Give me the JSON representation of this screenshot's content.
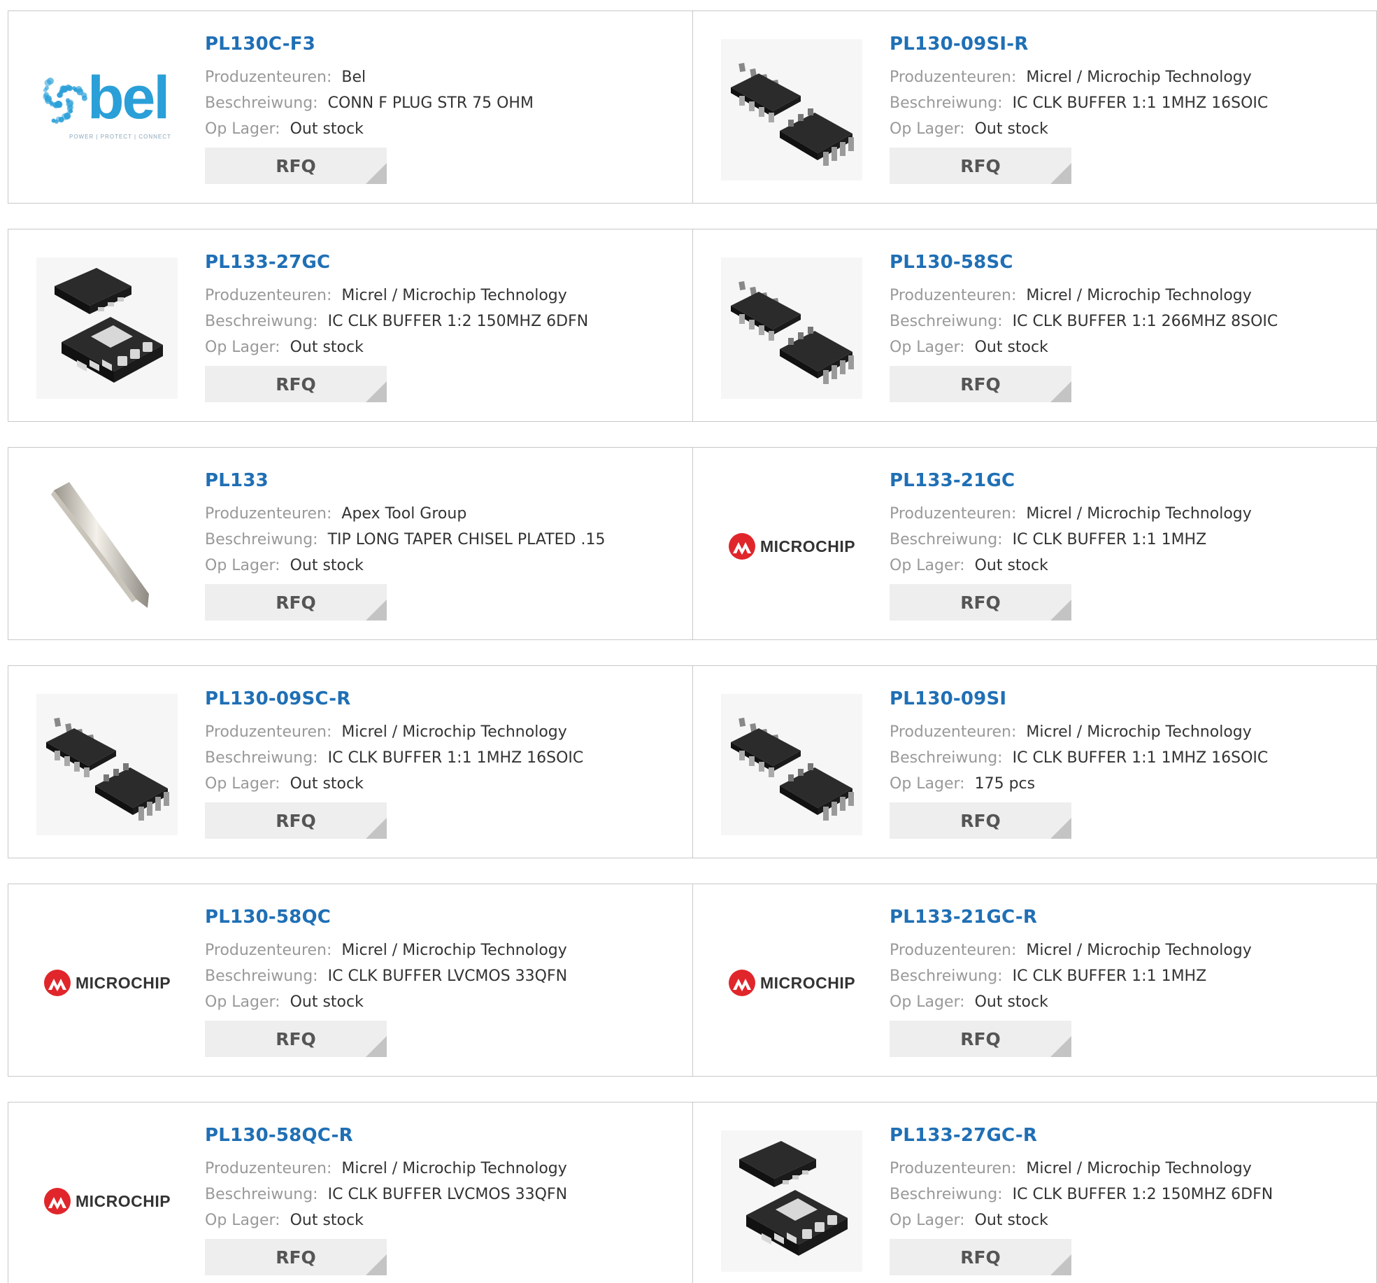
{
  "labels": {
    "manufacturer": "Produzenteuren:",
    "description": "Beschreiwung:",
    "stock": "Op Lager:",
    "rfq": "RFQ"
  },
  "logos": {
    "bel_word": "bel",
    "bel_tagline": "POWER | PROTECT | CONNECT",
    "microchip_word": "MICROCHIP"
  },
  "colors": {
    "link": "#1f6fb5",
    "bel": "#2a9fd8",
    "microchip": "#e0262b",
    "chip": "#2b2b2b"
  },
  "products": [
    {
      "part": "PL130C-F3",
      "manufacturer": "Bel",
      "description": "CONN F PLUG STR 75 OHM",
      "stock": "Out stock",
      "image": "bel-logo"
    },
    {
      "part": "PL130-09SI-R",
      "manufacturer": "Micrel / Microchip Technology",
      "description": "IC CLK BUFFER 1:1 1MHZ 16SOIC",
      "stock": "Out stock",
      "image": "soic-chip"
    },
    {
      "part": "PL133-27GC",
      "manufacturer": "Micrel / Microchip Technology",
      "description": "IC CLK BUFFER 1:2 150MHZ 6DFN",
      "stock": "Out stock",
      "image": "dfn-chip"
    },
    {
      "part": "PL130-58SC",
      "manufacturer": "Micrel / Microchip Technology",
      "description": "IC CLK BUFFER 1:1 266MHZ 8SOIC",
      "stock": "Out stock",
      "image": "soic-chip"
    },
    {
      "part": "PL133",
      "manufacturer": "Apex Tool Group",
      "description": "TIP LONG TAPER CHISEL PLATED .15",
      "stock": "Out stock",
      "image": "solder-tip"
    },
    {
      "part": "PL133-21GC",
      "manufacturer": "Micrel / Microchip Technology",
      "description": "IC CLK BUFFER 1:1 1MHZ",
      "stock": "Out stock",
      "image": "microchip-logo"
    },
    {
      "part": "PL130-09SC-R",
      "manufacturer": "Micrel / Microchip Technology",
      "description": "IC CLK BUFFER 1:1 1MHZ 16SOIC",
      "stock": "Out stock",
      "image": "soic-chip"
    },
    {
      "part": "PL130-09SI",
      "manufacturer": "Micrel / Microchip Technology",
      "description": "IC CLK BUFFER 1:1 1MHZ 16SOIC",
      "stock": "175 pcs",
      "image": "soic-chip"
    },
    {
      "part": "PL130-58QC",
      "manufacturer": "Micrel / Microchip Technology",
      "description": "IC CLK BUFFER LVCMOS 33QFN",
      "stock": "Out stock",
      "image": "microchip-logo"
    },
    {
      "part": "PL133-21GC-R",
      "manufacturer": "Micrel / Microchip Technology",
      "description": "IC CLK BUFFER 1:1 1MHZ",
      "stock": "Out stock",
      "image": "microchip-logo"
    },
    {
      "part": "PL130-58QC-R",
      "manufacturer": "Micrel / Microchip Technology",
      "description": "IC CLK BUFFER LVCMOS 33QFN",
      "stock": "Out stock",
      "image": "microchip-logo"
    },
    {
      "part": "PL133-27GC-R",
      "manufacturer": "Micrel / Microchip Technology",
      "description": "IC CLK BUFFER 1:2 150MHZ 6DFN",
      "stock": "Out stock",
      "image": "dfn-chip"
    }
  ]
}
